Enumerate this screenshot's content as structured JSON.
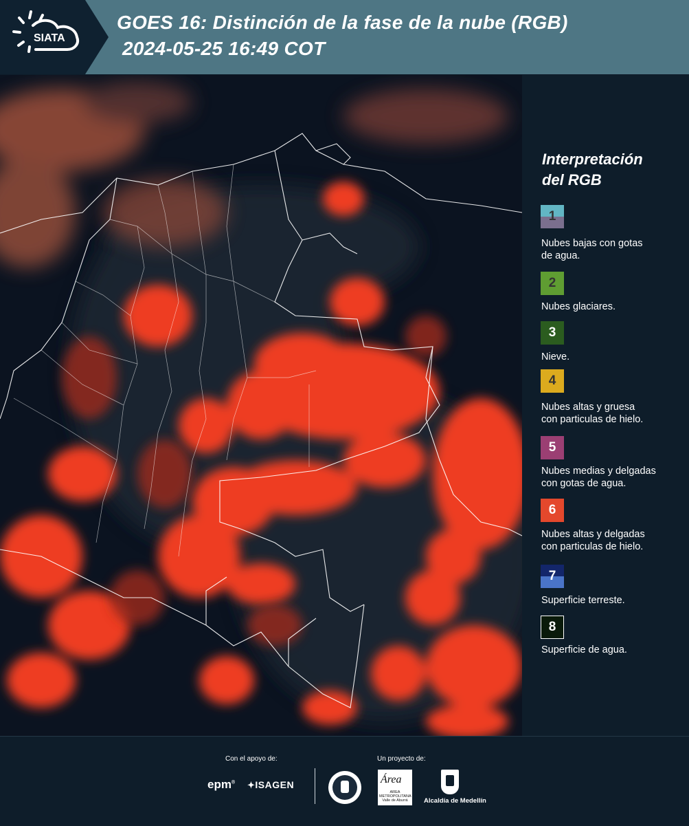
{
  "header": {
    "logo_text": "SIATA",
    "title_line1": "GOES 16: Distinción de la fase de la nube (RGB)",
    "title_line2": "2024-05-25 16:49 COT",
    "bg_color": "#4e7684"
  },
  "legend": {
    "title_line1": "Interpretación",
    "title_line2": "del RGB",
    "items": [
      {
        "number": "1",
        "label_line1": "Nubes bajas con gotas",
        "label_line2": "de agua.",
        "color_top": "#62b6c4",
        "color_bottom": "#7a6f8e"
      },
      {
        "number": "2",
        "label_line1": "Nubes glaciares.",
        "label_line2": "",
        "color_top": "#5f9d32",
        "color_bottom": "#5f9d32"
      },
      {
        "number": "3",
        "label_line1": "Nieve.",
        "label_line2": "",
        "color_top": "#2b5c1f",
        "color_bottom": "#2b5c1f"
      },
      {
        "number": "4",
        "label_line1": "Nubes altas y gruesa",
        "label_line2": "con particulas de hielo.",
        "color_top": "#dcab1e",
        "color_bottom": "#dcab1e"
      },
      {
        "number": "5",
        "label_line1": "Nubes medias y delgadas",
        "label_line2": "con gotas de agua.",
        "color_top": "#9b3f73",
        "color_bottom": "#9b3f73"
      },
      {
        "number": "6",
        "label_line1": "Nubes altas y delgadas",
        "label_line2": "con particulas de hielo.",
        "color_top": "#e4482c",
        "color_bottom": "#e4482c"
      },
      {
        "number": "7",
        "label_line1": "Superficie terreste.",
        "label_line2": "",
        "color_top": "#13266a",
        "color_bottom": "#4a74c8"
      },
      {
        "number": "8",
        "label_line1": "Superficie de agua.",
        "label_line2": "",
        "color_top": "#0a1a0a",
        "color_bottom": "#0a1a0a"
      }
    ]
  },
  "footer": {
    "support_label": "Con el apoyo de:",
    "project_label": "Un proyecto de:",
    "sponsor1": "epm",
    "sponsor2": "ISAGEN",
    "partner1_text": "AREA METROPOLITANA Valle de Aburrá",
    "partner1_logo_word": "Área",
    "partner2": "Alcaldía de Medellín"
  }
}
